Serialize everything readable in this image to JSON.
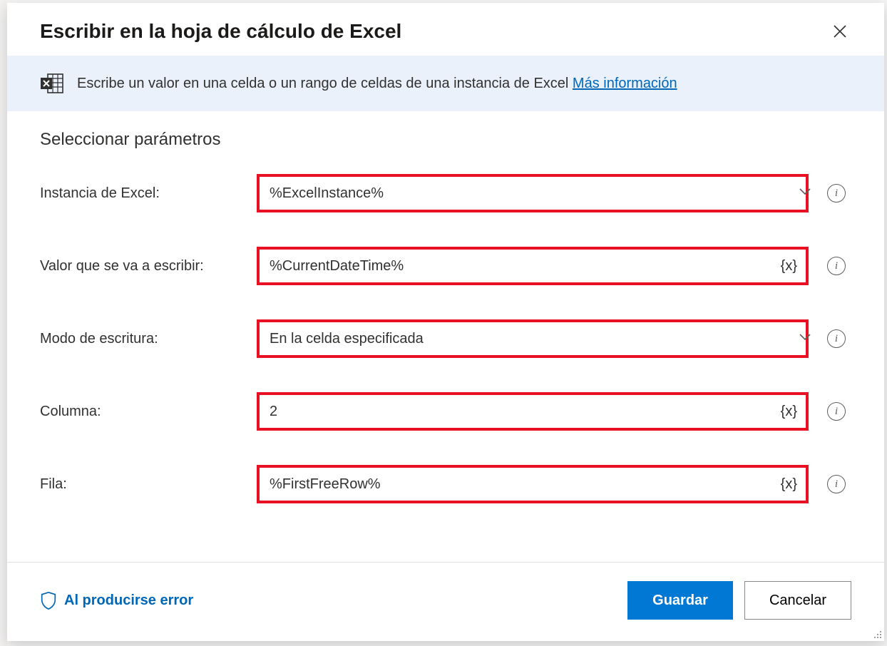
{
  "header": {
    "title": "Escribir en la hoja de cálculo de Excel"
  },
  "banner": {
    "text": "Escribe un valor en una celda o un rango de celdas de una instancia de Excel ",
    "link": "Más información"
  },
  "section": {
    "title": "Seleccionar parámetros"
  },
  "fields": {
    "instance": {
      "label": "Instancia de Excel:",
      "value": "%ExcelInstance%",
      "variable_btn": "",
      "has_dropdown": true
    },
    "value": {
      "label": "Valor que se va a escribir:",
      "value": "%CurrentDateTime%",
      "variable_btn": "{x}",
      "has_dropdown": false
    },
    "mode": {
      "label": "Modo de escritura:",
      "value": "En la celda especificada",
      "variable_btn": "",
      "has_dropdown": true
    },
    "column": {
      "label": "Columna:",
      "value": "2",
      "variable_btn": "{x}",
      "has_dropdown": false
    },
    "row": {
      "label": "Fila:",
      "value": "%FirstFreeRow%",
      "variable_btn": "{x}",
      "has_dropdown": false
    }
  },
  "footer": {
    "on_error": "Al producirse error",
    "save": "Guardar",
    "cancel": "Cancelar"
  }
}
